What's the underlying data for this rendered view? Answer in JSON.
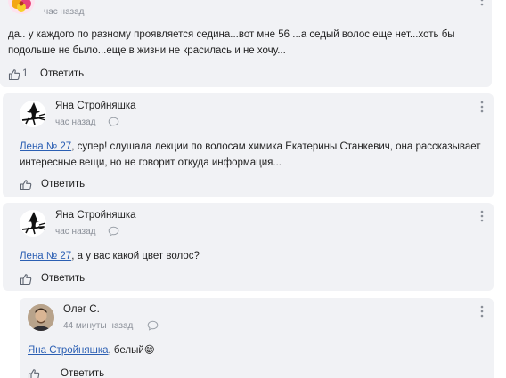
{
  "comments": [
    {
      "time": "час назад",
      "text": "да.. у каждого по разному проявляется седина...вот мне 56 ...а седый волос еще нет...хоть бы",
      "text2": "подольше  не было...еще  в жизни  не красилась и не хочу...",
      "likes": "1",
      "reply": "Ответить"
    },
    {
      "author": "Яна Стройняшка",
      "time": "час назад",
      "mention": "Лена № 27",
      "text": ", супер! слушала лекции по волосам химика Екатерины Станкевич, она рассказывает",
      "text2": "интересные вещи, но не говорит откуда информация...",
      "reply": "Ответить"
    },
    {
      "author": "Яна Стройняшка",
      "time": "час назад",
      "mention": "Лена № 27",
      "text": ", а у вас какой цвет волос?",
      "reply": "Ответить"
    },
    {
      "author": "Олег С.",
      "time": "44 минуты назад",
      "mention": "Яна Стройняшка",
      "text": ", белый",
      "emoji": "😁",
      "reply": "Ответить"
    }
  ]
}
